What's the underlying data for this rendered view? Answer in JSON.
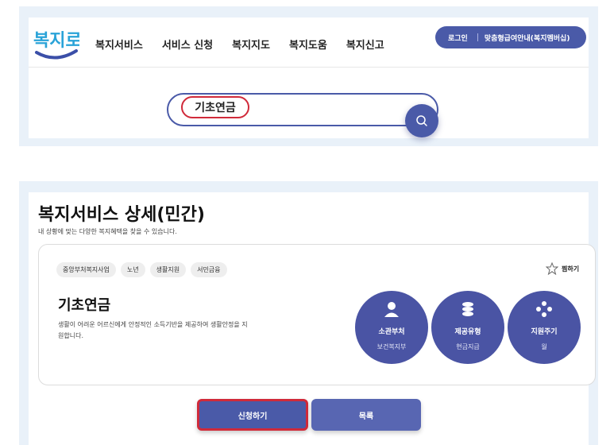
{
  "brand": {
    "logo_text": "복지로",
    "accent": "#4a5aa8",
    "highlight": "#d02a3a"
  },
  "nav": {
    "items": [
      "복지서비스",
      "서비스 신청",
      "복지지도",
      "복지도움",
      "복지신고"
    ]
  },
  "header": {
    "login": "로그인",
    "guide": "맞춤형급여안내(복지멤버십)"
  },
  "search": {
    "value": "기초연금",
    "button_icon": "search-icon"
  },
  "detail": {
    "title": "복지서비스 상세(민간)",
    "subtitle": "내 상황에 맞는 다양한 복지혜택을 찾을 수 있습니다.",
    "tags": [
      "중앙부처복지사업",
      "노년",
      "생활지원",
      "서민금융"
    ],
    "favorite_label": "찜하기",
    "service_name": "기초연금",
    "service_desc": "생활이 어려운 어르신에게 안정적인 소득기반을 제공하여 생활안정을 지원합니다.",
    "info": [
      {
        "label": "소관부처",
        "value": "보건복지부",
        "icon": "person-icon"
      },
      {
        "label": "제공유형",
        "value": "현금지급",
        "icon": "coins-icon"
      },
      {
        "label": "지원주기",
        "value": "월",
        "icon": "cycle-dots-icon"
      }
    ],
    "apply_label": "신청하기",
    "list_label": "목록"
  }
}
